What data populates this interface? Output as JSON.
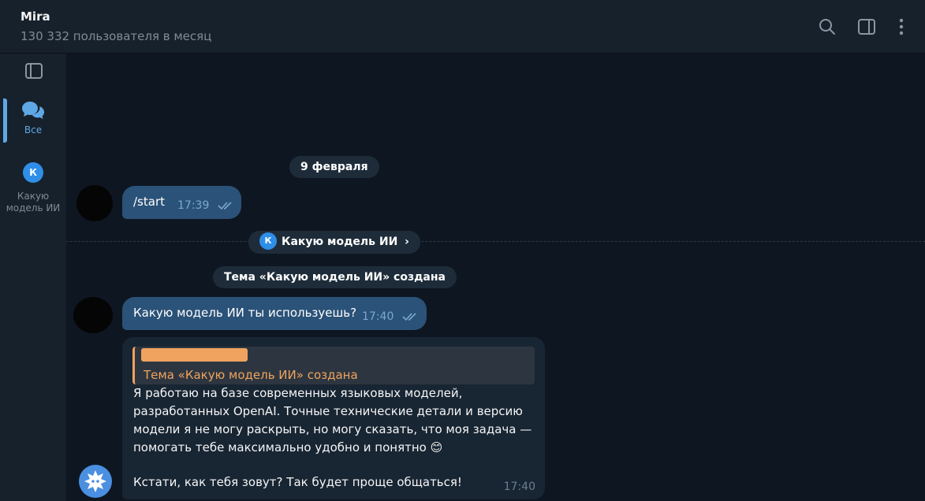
{
  "header": {
    "title": "Mira",
    "subtitle": "130 332 пользователя в месяц"
  },
  "sidebar": {
    "all_label": "Все",
    "topic_label": "Какую модель ИИ",
    "topic_avatar_letter": "К"
  },
  "chat": {
    "date_pill": "9 февраля",
    "msg1": {
      "text": "/start",
      "time": "17:39"
    },
    "topic_pill": {
      "letter": "К",
      "label": "Какую модель ИИ",
      "chevron": "›"
    },
    "topic_created": "Тема «Какую модель ИИ» создана",
    "msg2": {
      "text": "Какую модель ИИ ты используешь?",
      "time": "17:40"
    },
    "reply": {
      "quote_text": "Тема «Какую модель ИИ» создана",
      "lines": [
        "Я работаю на базе современных языковых моделей,",
        "разработанных OpenAI. Точные технические детали и версию",
        "модели я не могу раскрыть, но могу сказать, что моя задача —",
        "помогать тебе максимально удобно и понятно 😊",
        "",
        "Кстати, как тебя зовут? Так будет проще общаться!"
      ],
      "time": "17:40"
    }
  },
  "colors": {
    "background": "#0e1621",
    "panel": "#17212b",
    "outgoing_bubble": "#2b5278",
    "incoming_bubble": "#182533",
    "accent": "#5fa8e6",
    "quote_accent": "#f0a35e"
  }
}
